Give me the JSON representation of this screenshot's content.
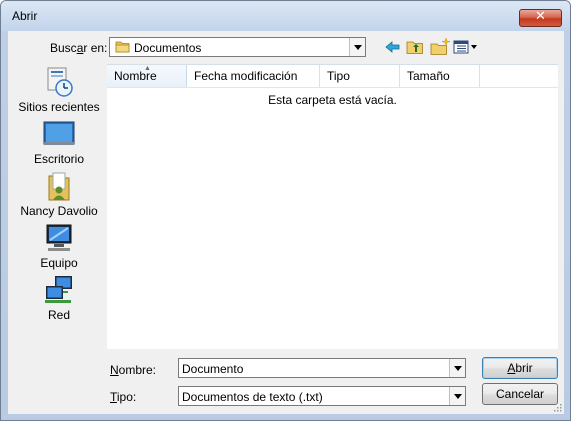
{
  "window": {
    "title": "Abrir"
  },
  "titlebar": {
    "close_icon": "close-x-icon",
    "close_glyph": "✕"
  },
  "look_in": {
    "label_pre": "Busc",
    "label_mn": "a",
    "label_post": "r en:",
    "value": "Documentos"
  },
  "toolbar": [
    "back-arrow-icon",
    "up-folder-icon",
    "new-folder-icon",
    "views-menu-icon"
  ],
  "places": [
    {
      "label": "Sitios recientes",
      "icon": "recent-places-icon"
    },
    {
      "label": "Escritorio",
      "icon": "desktop-icon"
    },
    {
      "label": "Nancy Davolio",
      "icon": "user-folder-icon"
    },
    {
      "label": "Equipo",
      "icon": "computer-icon"
    },
    {
      "label": "Red",
      "icon": "network-icon"
    }
  ],
  "filelist": {
    "columns": [
      "Nombre",
      "Fecha modificación",
      "Tipo",
      "Tamaño"
    ],
    "sorted_column": "Nombre",
    "empty_message": "Esta carpeta está vacía."
  },
  "filename": {
    "label_mn": "N",
    "label_rest": "ombre:",
    "value": "Documento"
  },
  "filetype": {
    "label_mn": "T",
    "label_rest": "ipo:",
    "value": "Documentos de texto (.txt)"
  },
  "buttons": {
    "open_mn": "A",
    "open_rest": "brir",
    "cancel": "Cancelar"
  },
  "colors": {
    "accent": "#3c7fb1",
    "close": "#c74a2e",
    "title_bg": "#c4d4e8"
  }
}
